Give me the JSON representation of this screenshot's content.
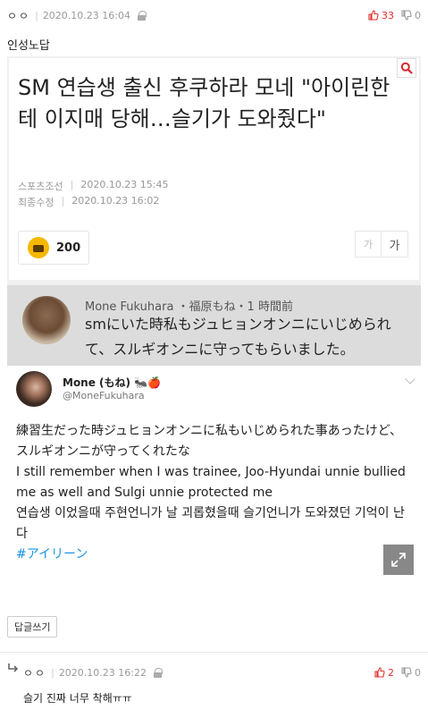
{
  "post": {
    "author": "ㅇㅇ",
    "date": "2020.10.23",
    "time": "16:04",
    "upvotes": "33",
    "downvotes": "0",
    "title": "인성노답"
  },
  "article": {
    "headline": "SM 연습생 출신 후쿠하라 모네 \"아이린한테 이지매 당해…슬기가 도와줬다\"",
    "source": "스포츠조선",
    "published": "2020.10.23 15:45",
    "modified_label": "최종수정",
    "modified": "2020.10.23 16:02",
    "reaction_count": "200",
    "font_small": "가",
    "font_large": "가"
  },
  "quote": {
    "author_line": "Mone Fukuhara ・福原もね・1 時間前",
    "text": "smにいた時私もジュヒョンオンニにいじめられて、スルギオンニに守ってもらいました。"
  },
  "tweet": {
    "name": "Mone (もね) 🐜🍎",
    "handle": "@MoneFukuhara",
    "line_jp": "練習生だった時ジュヒョンオンニに私もいじめられた事あったけど、スルギオンニが守ってくれたな",
    "line_en": "I still remember when I was trainee, Joo-Hyundai unnie bullied me as well and Sulgi unnie protected me",
    "line_kr": "연습생 이었을때 주현언니가 날 괴롭혔을때 슬기언니가 도와졌던 기억이 난다",
    "hashtag": "#アイリーン"
  },
  "reply_button": "답글쓰기",
  "reply": {
    "author": "ㅇㅇ",
    "date": "2020.10.23",
    "time": "16:22",
    "upvotes": "2",
    "downvotes": "0",
    "content": "슬기 진짜 너무 착해ㅠㅠ"
  },
  "colors": {
    "upvote": "#e0302a",
    "search_icon": "#d7282f",
    "hashtag": "#1b95e0"
  }
}
